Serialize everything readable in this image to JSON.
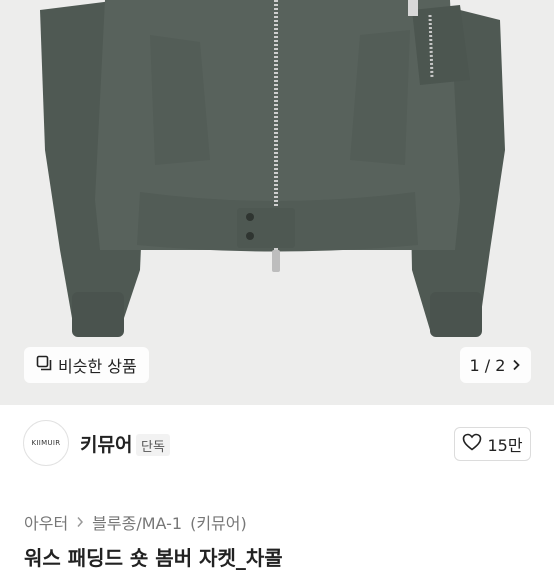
{
  "product_image": {
    "alt_subject": "jacket-photo"
  },
  "similar_button": {
    "label": "비슷한 상품"
  },
  "pager": {
    "text": "1 / 2"
  },
  "seller": {
    "avatar_text": "KIIMUIR",
    "name": "키뮤어",
    "badge": "단독",
    "like_count": "15만"
  },
  "breadcrumb": {
    "items": [
      "아우터",
      "블루종/MA-1",
      "(키뮤어)"
    ]
  },
  "product": {
    "title": "워스 패딩드 숏 봄버 자켓_차콜"
  },
  "colors": {
    "jacket": "#56605a",
    "background": "#ededec"
  }
}
